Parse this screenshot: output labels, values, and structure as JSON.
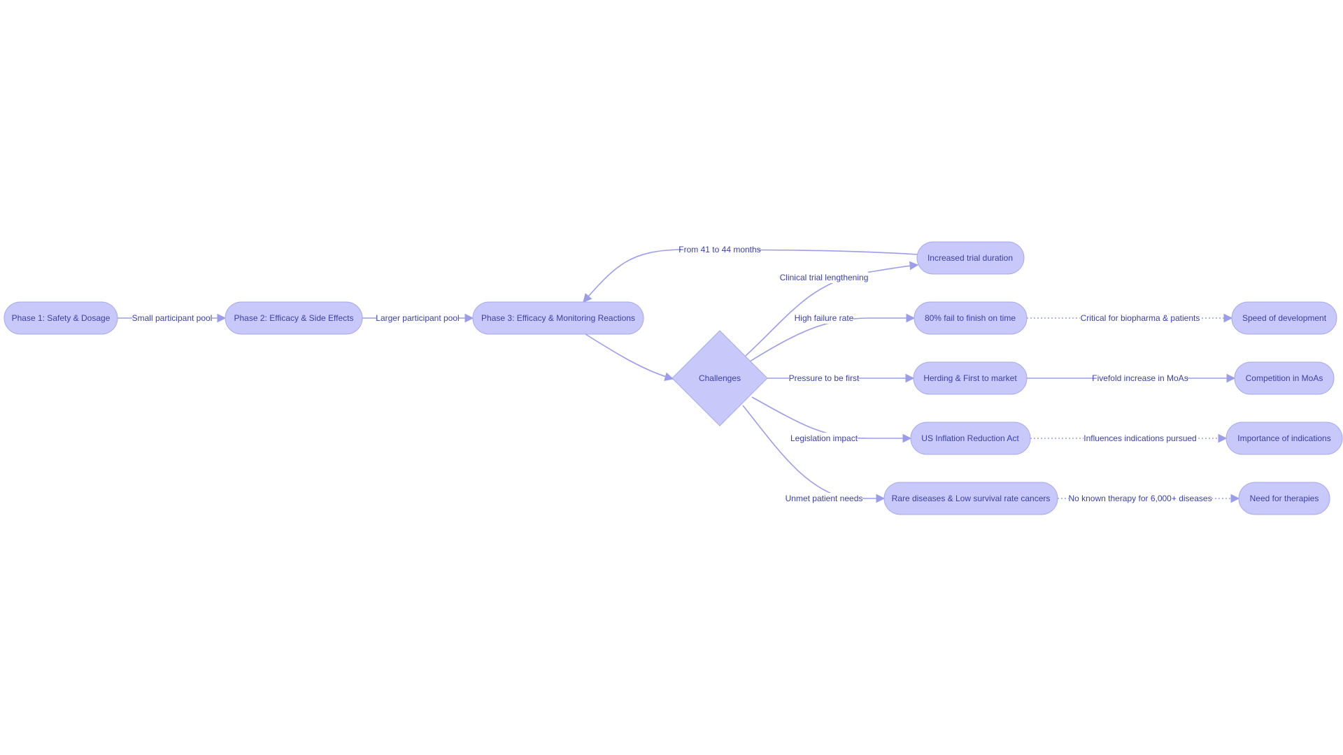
{
  "diagram": {
    "nodes": {
      "phase1": "Phase 1: Safety & Dosage",
      "phase2": "Phase 2: Efficacy & Side Effects",
      "phase3": "Phase 3: Efficacy & Monitoring Reactions",
      "challenges": "Challenges",
      "increased_duration": "Increased trial duration",
      "fail_rate": "80% fail to finish on time",
      "herding": "Herding & First to market",
      "ira": "US Inflation Reduction Act",
      "rare": "Rare diseases & Low survival rate cancers",
      "speed": "Speed of development",
      "competition": "Competition in MoAs",
      "indications": "Importance of indications",
      "therapies": "Need for therapies"
    },
    "edges": {
      "p1_p2": "Small participant pool",
      "p2_p3": "Larger participant pool",
      "dur_p3": "From 41 to 44 months",
      "ch_dur": "Clinical trial lengthening",
      "ch_fail": "High failure rate",
      "ch_herd": "Pressure to be first",
      "ch_ira": "Legislation impact",
      "ch_rare": "Unmet patient needs",
      "fail_speed": "Critical for biopharma & patients",
      "herd_comp": "Fivefold increase in MoAs",
      "ira_ind": "Influences indications pursued",
      "rare_ther": "No known therapy for 6,000+ diseases"
    },
    "colors": {
      "node_fill": "#c8c9fa",
      "node_stroke": "#a6a8ec",
      "edge": "#9b9deb",
      "text": "#3b3fa8"
    }
  }
}
